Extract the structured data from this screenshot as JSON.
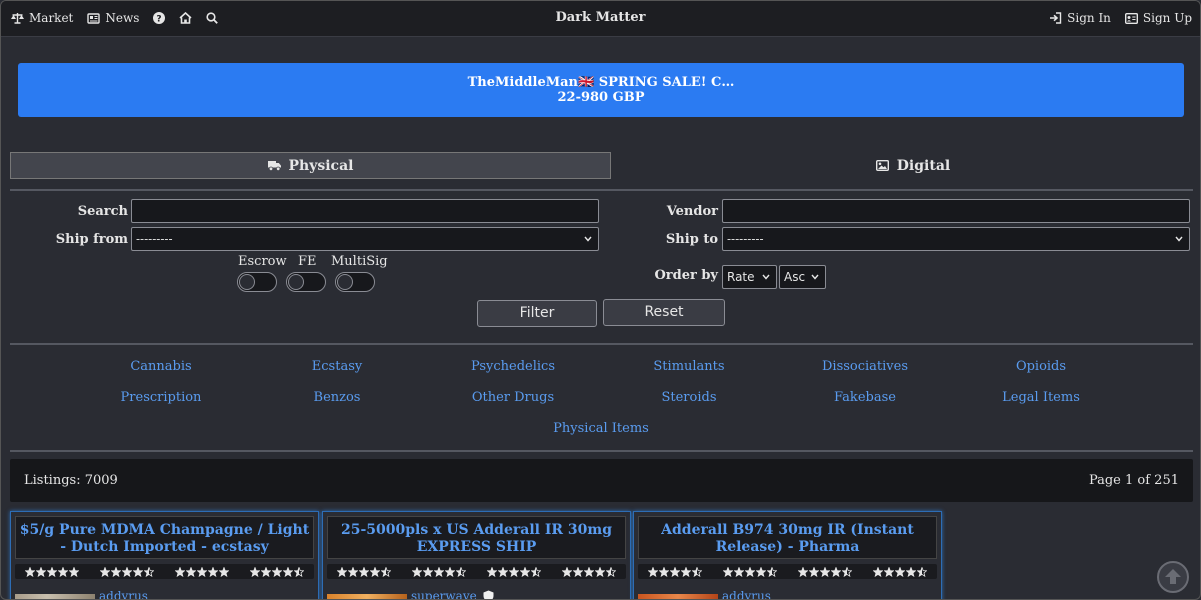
{
  "nav": {
    "market": "Market",
    "news": "News",
    "brand": "Dark Matter",
    "sign_in": "Sign In",
    "sign_up": "Sign Up"
  },
  "banner": {
    "line1": "TheMiddleMan🇬🇧 SPRING SALE! C…",
    "line2": "22-980 GBP"
  },
  "tabs": {
    "physical": "Physical",
    "digital": "Digital"
  },
  "filters": {
    "search_label": "Search",
    "vendor_label": "Vendor",
    "ship_from_label": "Ship from",
    "ship_from_value": "---------",
    "ship_to_label": "Ship to",
    "ship_to_value": "---------",
    "escrow": "Escrow",
    "fe": "FE",
    "multisig": "MultiSig",
    "order_by_label": "Order by",
    "order_by_value": "Rate",
    "order_dir_value": "Asc",
    "filter_button": "Filter",
    "reset_button": "Reset"
  },
  "categories": [
    "Cannabis",
    "Ecstasy",
    "Psychedelics",
    "Stimulants",
    "Dissociatives",
    "Opioids",
    "Prescription",
    "Benzos",
    "Other Drugs",
    "Steroids",
    "Fakebase",
    "Legal Items",
    "Physical Items"
  ],
  "listing": {
    "count": "Listings: 7009",
    "page": "Page 1 of 251"
  },
  "products": [
    {
      "title": "$5/g Pure MDMA Champagne / Light - Dutch Imported - ecstasy",
      "vendor": "addyrus",
      "ratings": [
        5,
        4.5,
        5,
        4.5
      ]
    },
    {
      "title": "25-5000pls x US Adderall IR 30mg EXPRESS SHIP",
      "vendor": "superwave",
      "ratings": [
        4.5,
        4.5,
        4.5,
        4.5
      ]
    },
    {
      "title": "Adderall B974 30mg IR (Instant Release) - Pharma",
      "vendor": "addyrus",
      "ratings": [
        4.5,
        4.5,
        4.5,
        4.5
      ]
    }
  ],
  "colors": {
    "accent": "#2b7bf2",
    "link": "#5a9cf0",
    "background": "#2a2c33"
  }
}
